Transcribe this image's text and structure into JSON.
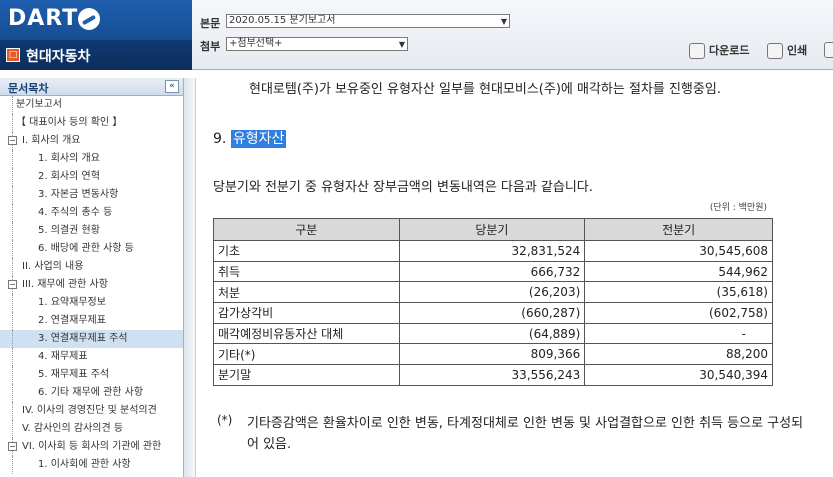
{
  "brand": {
    "logo_text": "DART",
    "company_name": "현대자동차",
    "company_icon": "doc-icon"
  },
  "header": {
    "main_label": "본문",
    "main_value": "2020.05.15  분기보고서",
    "attach_label": "첨부",
    "attach_value": "+첨부선택+",
    "download_label": "다운로드",
    "print_label": "인쇄"
  },
  "sidebar": {
    "title": "문서목차",
    "collapse_glyph": "«",
    "items": [
      {
        "label": "분기보고서",
        "level": 0,
        "toggle": ""
      },
      {
        "label": "【 대표이사 등의 확인 】",
        "level": 0,
        "toggle": ""
      },
      {
        "label": "I. 회사의 개요",
        "level": 1,
        "toggle": "−"
      },
      {
        "label": "1. 회사의 개요",
        "level": 2,
        "toggle": ""
      },
      {
        "label": "2. 회사의 연혁",
        "level": 2,
        "toggle": ""
      },
      {
        "label": "3. 자본금 변동사항",
        "level": 2,
        "toggle": ""
      },
      {
        "label": "4. 주식의 총수 등",
        "level": 2,
        "toggle": ""
      },
      {
        "label": "5. 의결권 현황",
        "level": 2,
        "toggle": ""
      },
      {
        "label": "6. 배당에 관한 사항 등",
        "level": 2,
        "toggle": ""
      },
      {
        "label": "II. 사업의 내용",
        "level": 1,
        "toggle": ""
      },
      {
        "label": "III. 재무에 관한 사항",
        "level": 1,
        "toggle": "−"
      },
      {
        "label": "1. 요약재무정보",
        "level": 2,
        "toggle": ""
      },
      {
        "label": "2. 연결재무제표",
        "level": 2,
        "toggle": ""
      },
      {
        "label": "3. 연결재무제표 주석",
        "level": 2,
        "toggle": "",
        "selected": true
      },
      {
        "label": "4. 재무제표",
        "level": 2,
        "toggle": ""
      },
      {
        "label": "5. 재무제표 주석",
        "level": 2,
        "toggle": ""
      },
      {
        "label": "6. 기타 재무에 관한 사항",
        "level": 2,
        "toggle": ""
      },
      {
        "label": "IV. 이사의 경영진단 및 분석의견",
        "level": 1,
        "toggle": ""
      },
      {
        "label": "V. 감사인의 감사의견 등",
        "level": 1,
        "toggle": ""
      },
      {
        "label": "VI. 이사회 등 회사의 기관에 관한",
        "level": 1,
        "toggle": "−"
      },
      {
        "label": "1. 이사회에 관한 사항",
        "level": 2,
        "toggle": ""
      }
    ]
  },
  "content": {
    "intro_line": "현대로템(주)가 보유중인 유형자산 일부를 현대모비스(주)에 매각하는 절차를 진행중임.",
    "section_number": "9.",
    "section_title": "유형자산",
    "description": "당분기와 전분기 중 유형자산 장부금액의 변동내역은 다음과 같습니다.",
    "unit": "(단위 : 백만원)",
    "table": {
      "headers": [
        "구분",
        "당분기",
        "전분기"
      ],
      "rows": [
        [
          "기초",
          "32,831,524",
          "30,545,608"
        ],
        [
          "취득",
          "666,732",
          "544,962"
        ],
        [
          "처분",
          "(26,203)",
          "(35,618)"
        ],
        [
          "감가상각비",
          "(660,287)",
          "(602,758)"
        ],
        [
          "매각예정비유동자산 대체",
          "(64,889)",
          "-"
        ],
        [
          "기타(*)",
          "809,366",
          "88,200"
        ],
        [
          "분기말",
          "33,556,243",
          "30,540,394"
        ]
      ]
    },
    "note_mark": "(*)",
    "note_text": "기타증감액은 환율차이로 인한 변동, 타계정대체로 인한 변동 및 사업결합으로 인한 취득 등으로 구성되어 있음."
  }
}
